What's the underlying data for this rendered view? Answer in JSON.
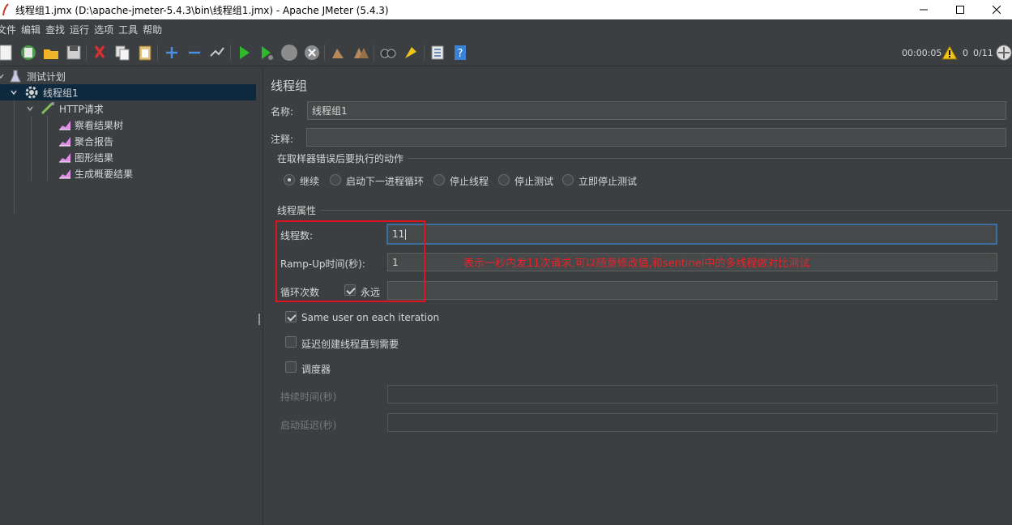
{
  "window": {
    "title": "线程组1.jmx (D:\\apache-jmeter-5.4.3\\bin\\线程组1.jmx) - Apache JMeter (5.4.3)"
  },
  "menu": [
    "文件",
    "编辑",
    "查找",
    "运行",
    "选项",
    "工具",
    "帮助"
  ],
  "toolbar": {
    "elapsed_time": "00:00:05",
    "warning_count": "0",
    "threads": "0/11"
  },
  "tree": {
    "root": "测试计划",
    "thread_group": "线程组1",
    "sampler": "HTTP请求",
    "listeners": [
      "察看结果树",
      "聚合报告",
      "图形结果",
      "生成概要结果"
    ]
  },
  "panel": {
    "title": "线程组",
    "name_label": "名称:",
    "name_value": "线程组1",
    "comment_label": "注释:",
    "comment_value": "",
    "error_action_title": "在取样器错误后要执行的动作",
    "error_actions": [
      "继续",
      "启动下一进程循环",
      "停止线程",
      "停止测试",
      "立即停止测试"
    ],
    "error_action_selected": 0,
    "thread_props_title": "线程属性",
    "threads_label": "线程数:",
    "threads_value": "11",
    "rampup_label": "Ramp-Up时间(秒):",
    "rampup_value": "1",
    "loop_label": "循环次数",
    "forever_label": "永远",
    "forever_checked": true,
    "loop_value": "",
    "same_user_label": "Same user on each iteration",
    "same_user_checked": true,
    "delay_create_label": "延迟创建线程直到需要",
    "delay_create_checked": false,
    "scheduler_label": "调度器",
    "scheduler_checked": false,
    "duration_label": "持续时间(秒)",
    "duration_value": "",
    "startup_delay_label": "启动延迟(秒)",
    "startup_delay_value": "",
    "annotation": "表示一秒内发11次请求,可以随意修改值,和sentinel中的多线程做对比测试"
  },
  "colors": {
    "background": "#3c3f41",
    "selection": "#0d293e",
    "annotation_red": "#e0141e"
  }
}
